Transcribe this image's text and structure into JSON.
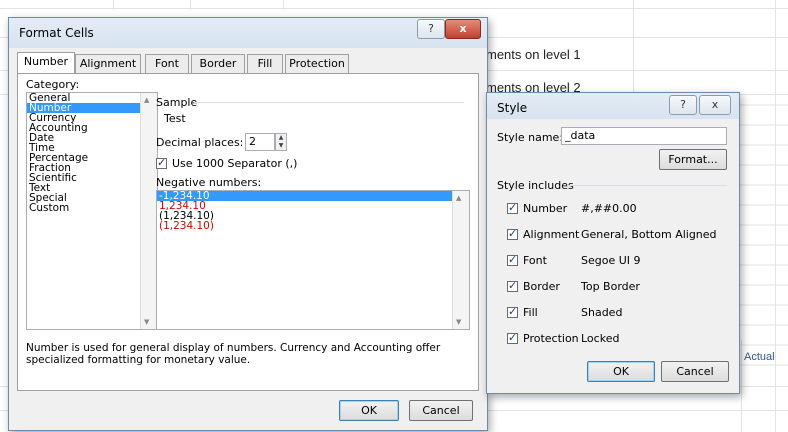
{
  "spreadsheet": {
    "text_rows": [
      "ments on level 1",
      "ments on level 2"
    ],
    "actual_label": "Actual"
  },
  "format_cells": {
    "title": "Format Cells",
    "tabs": [
      "Number",
      "Alignment",
      "Font",
      "Border",
      "Fill",
      "Protection"
    ],
    "category_label": "Category:",
    "categories": [
      "General",
      "Number",
      "Currency",
      "Accounting",
      "Date",
      "Time",
      "Percentage",
      "Fraction",
      "Scientific",
      "Text",
      "Special",
      "Custom"
    ],
    "selected_category": "Number",
    "sample_label": "Sample",
    "sample_value": "Test",
    "decimal_label": "Decimal places:",
    "decimal_value": "2",
    "separator_label": "Use 1000 Separator (,)",
    "separator_checked": true,
    "negative_label": "Negative numbers:",
    "negative_options": [
      {
        "text": "-1,234.10",
        "color": "#000000",
        "selected": true
      },
      {
        "text": "1,234.10",
        "color": "#e00000",
        "selected": false
      },
      {
        "text": "(1,234.10)",
        "color": "#000000",
        "selected": false
      },
      {
        "text": "(1,234.10)",
        "color": "#e00000",
        "selected": false
      }
    ],
    "description": "Number is used for general display of numbers.  Currency and Accounting offer specialized formatting for monetary value.",
    "ok_label": "OK",
    "cancel_label": "Cancel",
    "help_glyph": "?",
    "close_glyph": "x"
  },
  "style_dialog": {
    "title": "Style",
    "style_name_label": "Style name:",
    "style_name_value": "_data",
    "format_button": "Format...",
    "includes_label": "Style includes",
    "items": [
      {
        "label": "Number",
        "value": "#,##0.00",
        "checked": true
      },
      {
        "label": "Alignment",
        "value": "General, Bottom Aligned",
        "checked": true
      },
      {
        "label": "Font",
        "value": "Segoe UI 9",
        "checked": true
      },
      {
        "label": "Border",
        "value": "Top Border",
        "checked": true
      },
      {
        "label": "Fill",
        "value": "Shaded",
        "checked": true
      },
      {
        "label": "Protection",
        "value": "Locked",
        "checked": true
      }
    ],
    "ok_label": "OK",
    "cancel_label": "Cancel",
    "help_glyph": "?",
    "close_glyph": "x"
  }
}
